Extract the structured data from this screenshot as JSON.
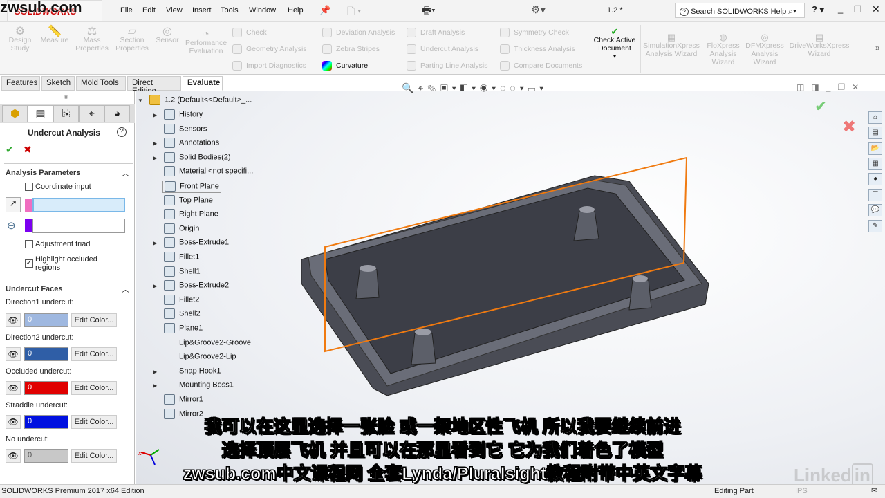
{
  "watermark": "zwsub.com",
  "app": {
    "logo": "SOLIDWORKS",
    "doc_title": "1.2 *"
  },
  "menu": [
    "File",
    "Edit",
    "View",
    "Insert",
    "Tools",
    "Window",
    "Help"
  ],
  "search": {
    "placeholder": "Search SOLIDWORKS Help"
  },
  "ribbon": {
    "big": [
      {
        "label": "Design Study"
      },
      {
        "label": "Measure"
      },
      {
        "label": "Mass Properties"
      },
      {
        "label": "Section Properties"
      },
      {
        "label": "Sensor"
      },
      {
        "label": "Performance Evaluation"
      }
    ],
    "col1": [
      "Check",
      "Geometry Analysis",
      "Import Diagnostics"
    ],
    "col2": [
      "Deviation Analysis",
      "Zebra Stripes",
      "Curvature"
    ],
    "col3": [
      "Draft Analysis",
      "Undercut Analysis",
      "Parting Line Analysis"
    ],
    "col4": [
      "Symmetry Check",
      "Thickness Analysis",
      "Compare Documents"
    ],
    "check_active": "Check Active Document",
    "xpress": [
      "SimulationXpress Analysis Wizard",
      "FloXpress Analysis Wizard",
      "DFMXpress Analysis Wizard",
      "DriveWorksXpress Wizard"
    ]
  },
  "tabs": [
    "Features",
    "Sketch",
    "Mold Tools",
    "Direct Editing",
    "Evaluate"
  ],
  "active_tab": "Evaluate",
  "panel": {
    "title": "Undercut Analysis",
    "params_header": "Analysis Parameters",
    "coordinate_input": {
      "label": "Coordinate input",
      "checked": false
    },
    "direction_color": "#f06ec0",
    "plane_color": "#7b00f0",
    "adjustment_triad": {
      "label": "Adjustment triad",
      "checked": false
    },
    "highlight_occluded": {
      "label": "Highlight occluded regions",
      "checked": true
    },
    "faces_header": "Undercut Faces",
    "edit_label": "Edit Color...",
    "faces": [
      {
        "label": "Direction1 undercut:",
        "count": "0",
        "color": "#9fb8e0"
      },
      {
        "label": "Direction2 undercut:",
        "count": "0",
        "color": "#2f5ea6"
      },
      {
        "label": "Occluded undercut:",
        "count": "0",
        "color": "#e00000"
      },
      {
        "label": "Straddle undercut:",
        "count": "0",
        "color": "#0010e0"
      },
      {
        "label": "No undercut:",
        "count": "0",
        "color": "#c8c8c8"
      }
    ]
  },
  "tree": {
    "root": "1.2  (Default<<Default>_...",
    "items": [
      "History",
      "Sensors",
      "Annotations",
      "Solid Bodies(2)",
      "Material <not specifi...",
      "Front Plane",
      "Top Plane",
      "Right Plane",
      "Origin",
      "Boss-Extrude1",
      "Fillet1",
      "Shell1",
      "Boss-Extrude2",
      "Fillet2",
      "Shell2",
      "Plane1",
      "Lip&Groove2-Groove",
      "Lip&Groove2-Lip",
      "Snap Hook1",
      "Mounting Boss1",
      "Mirror1",
      "Mirror2"
    ]
  },
  "subtitles": [
    "我可以在这里选择一张脸 或一架地区性飞机 所以我要继续前进",
    "选择顶层飞机 并且可以在那里看到它 它为我们着色了模型",
    "zwsub.com中文课程网 全套Lynda/Pluralsight教程附带中英文字幕"
  ],
  "status": {
    "edition": "SOLIDWORKS Premium 2017 x64 Edition",
    "mode": "Editing Part",
    "units": "IPS"
  },
  "linkedin": "LinkedIn"
}
